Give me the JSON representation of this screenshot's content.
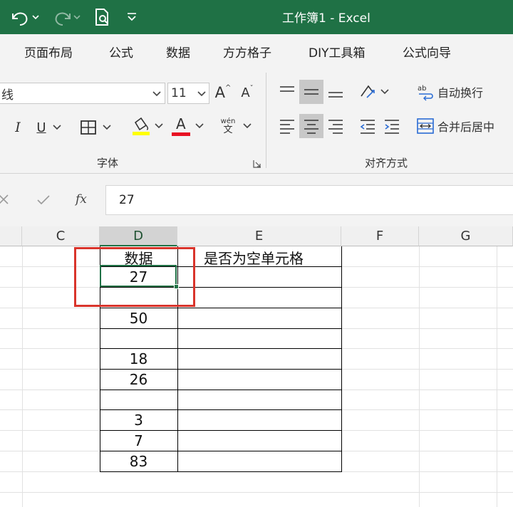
{
  "window": {
    "title": "工作簿1  -  Excel"
  },
  "tabs": [
    "页面布局",
    "公式",
    "数据",
    "方方格子",
    "DIY工具箱",
    "公式向导"
  ],
  "ribbon": {
    "font_name": "线",
    "font_size": "11",
    "wrap_text_label": "自动换行",
    "merge_center_label": "合并后居中",
    "font_group_label": "字体",
    "align_group_label": "对齐方式",
    "italic": "I",
    "underline": "U",
    "grow_font": "A",
    "shrink_font": "A",
    "font_color": "A",
    "phonetic_top": "wén",
    "phonetic_bottom": "文",
    "fill_color": "#ffff00",
    "font_color_hex": "#e81123"
  },
  "formula_bar": {
    "fx_label": "fx",
    "value": "27"
  },
  "sheet": {
    "columns": [
      "C",
      "D",
      "E",
      "F",
      "G"
    ],
    "selected_column": "D",
    "header_d": "数据",
    "header_e": "是否为空单元格",
    "values": [
      "27",
      "",
      "50",
      "",
      "18",
      "26",
      "",
      "3",
      "7",
      "83"
    ]
  },
  "colors": {
    "excel_green": "#1f7145",
    "highlight_red": "#d9342b"
  }
}
